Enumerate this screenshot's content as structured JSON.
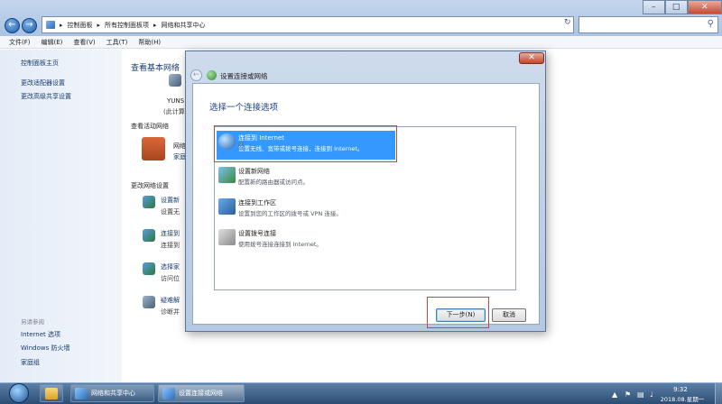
{
  "window": {
    "breadcrumb": [
      "控制面板",
      "所有控制面板项",
      "网络和共享中心"
    ],
    "address_sep": "▸",
    "refresh_icon": "refresh-icon",
    "search_icon": "search-icon",
    "controls": {
      "minimize": "–",
      "maximize": "□",
      "close": "✕"
    }
  },
  "menu": [
    "文件(F)",
    "编辑(E)",
    "查看(V)",
    "工具(T)",
    "帮助(H)"
  ],
  "sidebar": {
    "links": [
      "控制面板主页",
      "更改适配器设置",
      "更改高级共享设置"
    ],
    "see_also_title": "另请参阅",
    "see_also": [
      "Internet 选项",
      "Windows 防火墙",
      "家庭组"
    ]
  },
  "content": {
    "title": "查看基本网络",
    "computer_name": "YUNS",
    "computer_sub": "(此计算",
    "active_networks": "查看活动网络",
    "network_name": "网络",
    "network_type": "家庭",
    "change_settings": "更改网络设置",
    "items": [
      {
        "link": "设置新",
        "desc": "设置无"
      },
      {
        "link": "连接到",
        "desc": "连接到"
      },
      {
        "link": "选择家",
        "desc": "访问位"
      },
      {
        "link": "疑难解",
        "desc": "诊断并"
      }
    ]
  },
  "dialog": {
    "title": "设置连接或网络",
    "heading": "选择一个连接选项",
    "options": [
      {
        "title": "连接到 Internet",
        "desc": "设置无线、宽带或拨号连接，连接到 Internet。",
        "selected": true
      },
      {
        "title": "设置新网络",
        "desc": "配置新的路由器或访问点。",
        "selected": false
      },
      {
        "title": "连接到工作区",
        "desc": "设置到您的工作区的拨号或 VPN 连接。",
        "selected": false
      },
      {
        "title": "设置拨号连接",
        "desc": "使用拨号连接连接到 Internet。",
        "selected": false
      }
    ],
    "next_label": "下一步(N)",
    "cancel_label": "取消",
    "close_glyph": "✕",
    "back_glyph": "←"
  },
  "taskbar": {
    "items": [
      "网络和共享中心",
      "设置连接或网络"
    ],
    "time": "9:32",
    "date": "2018.08.星期一"
  },
  "colors": {
    "selection": "#3399ff",
    "annotation": "#e53a3a",
    "link": "#1a3a6e"
  }
}
